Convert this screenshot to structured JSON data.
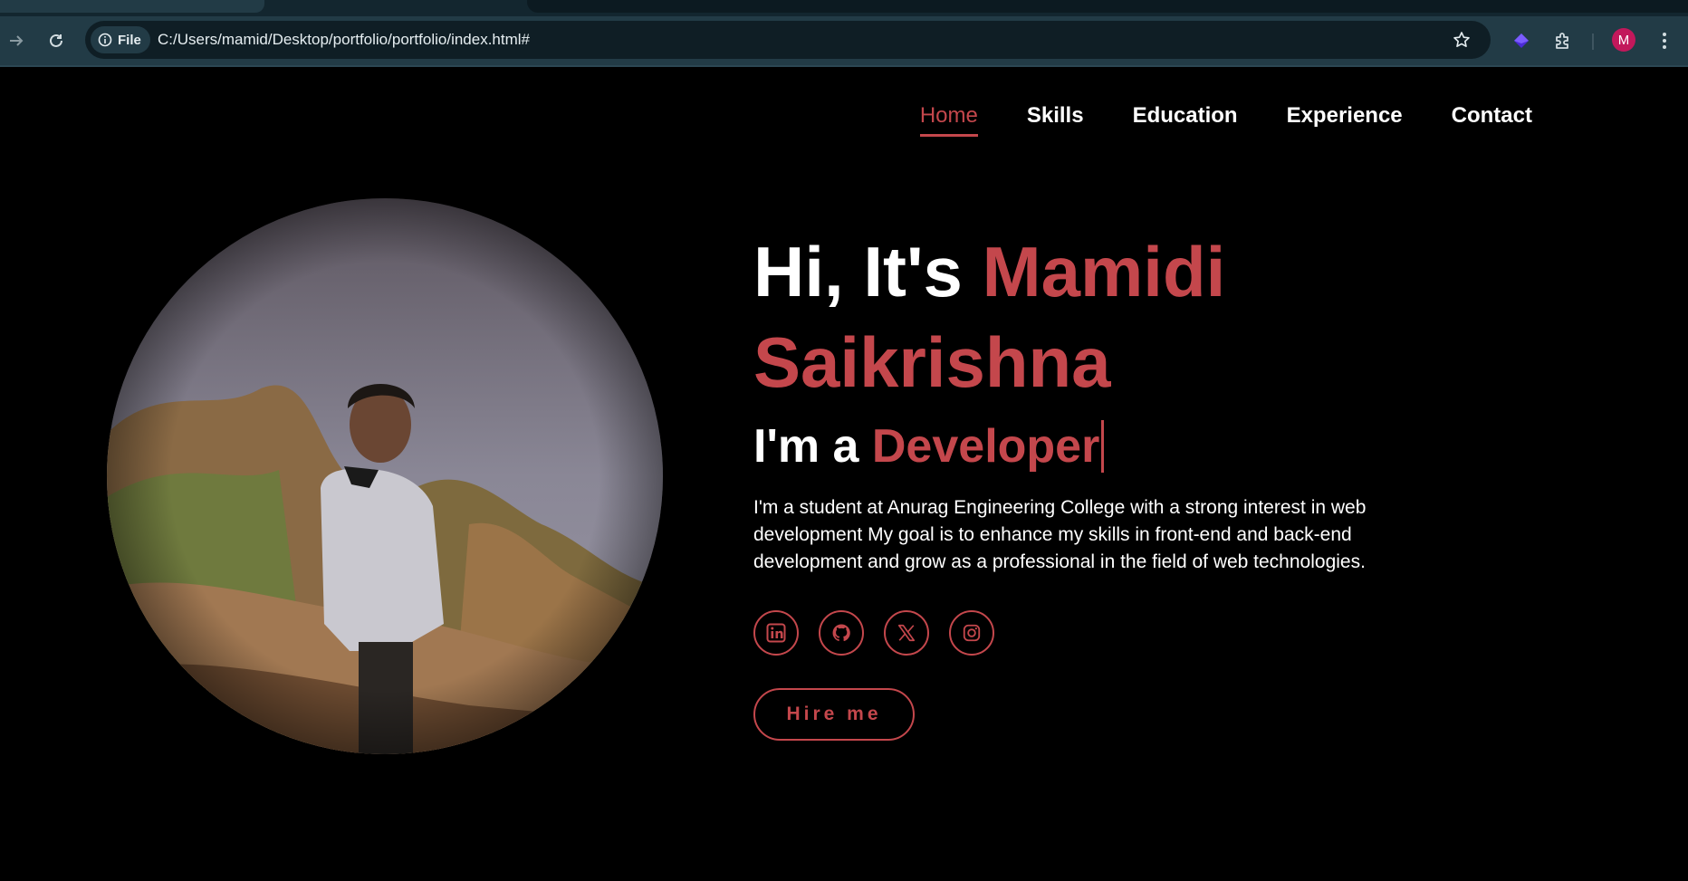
{
  "browser": {
    "omnibox": {
      "chip_label": "File",
      "url": "C:/Users/mamid/Desktop/portfolio/portfolio/index.html#"
    },
    "profile_initial": "M"
  },
  "nav": {
    "items": [
      {
        "label": "Home",
        "active": true
      },
      {
        "label": "Skills",
        "active": false
      },
      {
        "label": "Education",
        "active": false
      },
      {
        "label": "Experience",
        "active": false
      },
      {
        "label": "Contact",
        "active": false
      }
    ]
  },
  "hero": {
    "greeting": "Hi, It's",
    "name": "Mamidi Saikrishna",
    "role_prefix": "I'm a",
    "role": "Developer",
    "description": "I'm a student at Anurag Engineering College with a strong interest in web development My goal is to enhance my skills in front-end and back-end development and grow as a professional in the field of web technologies.",
    "socials": [
      "linkedin-icon",
      "github-icon",
      "x-icon",
      "instagram-icon"
    ],
    "cta_label": "Hire me"
  },
  "colors": {
    "accent": "#c4474c",
    "background": "#000000",
    "browser_toolbar": "#223b46",
    "omnibox": "#0f1e25"
  }
}
